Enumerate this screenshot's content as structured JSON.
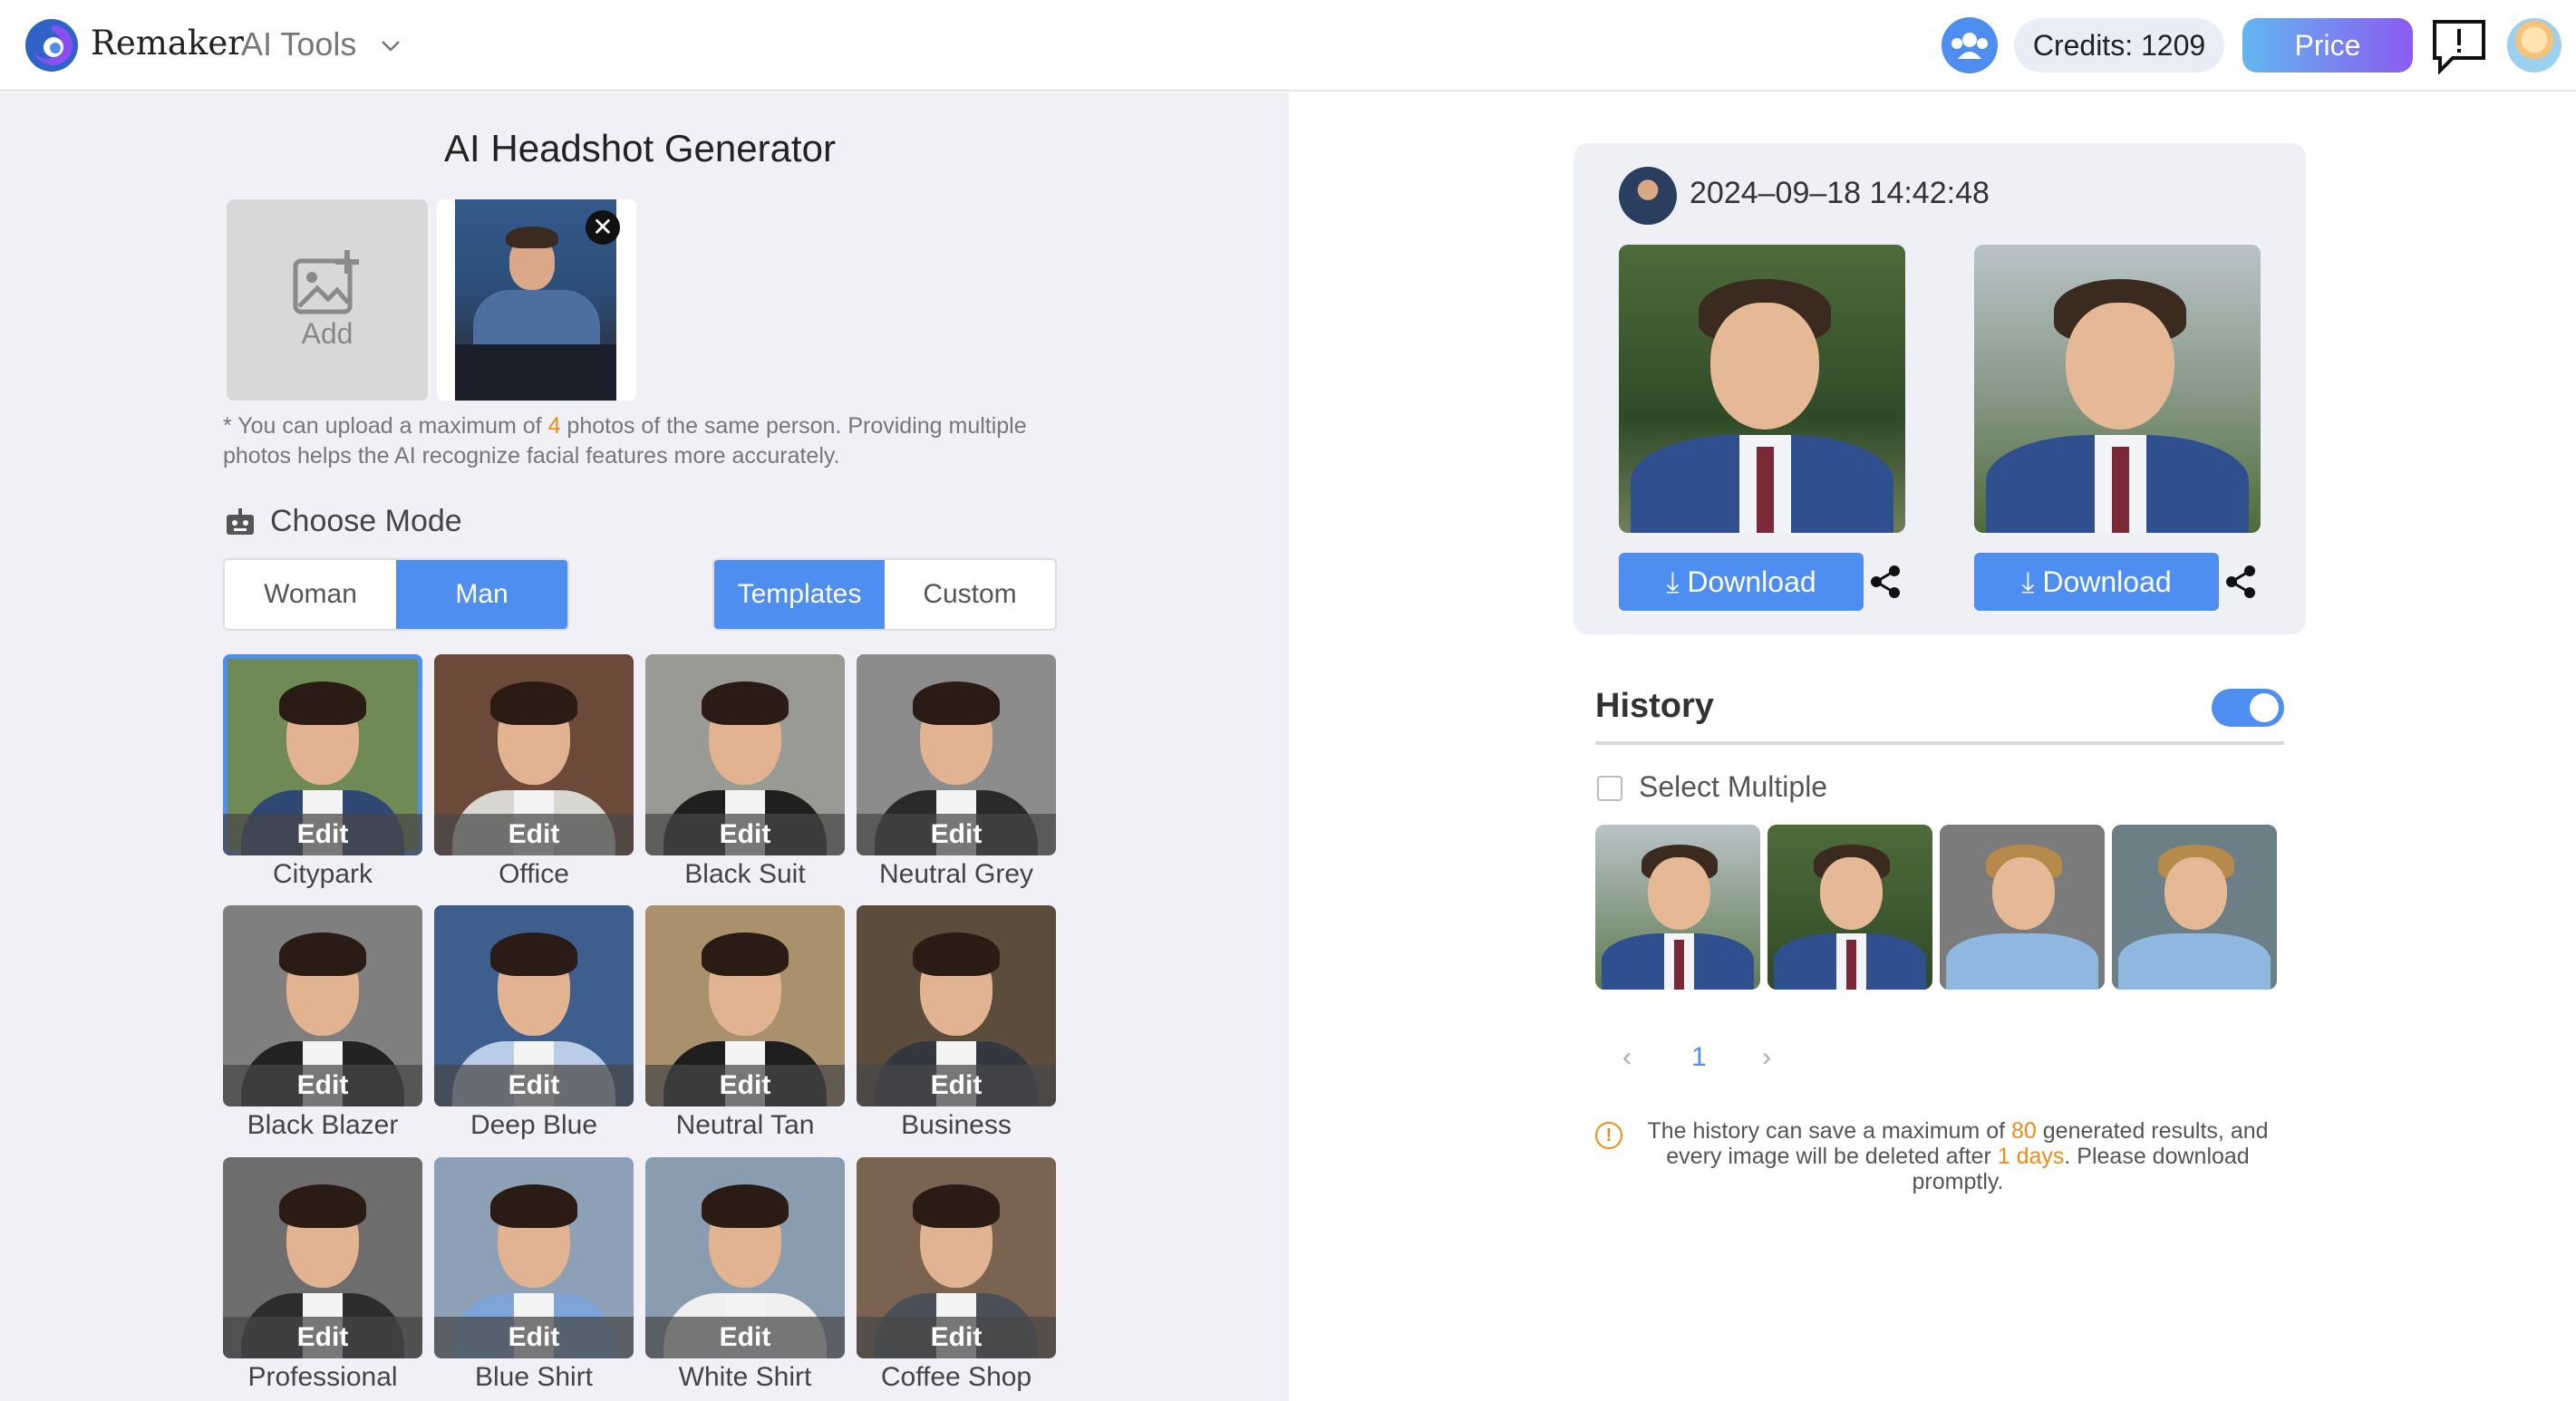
{
  "header": {
    "brand": "Remaker",
    "tools_label": "AI Tools",
    "credits": "Credits: 1209",
    "price_label": "Price"
  },
  "generator": {
    "title": "AI Headshot Generator",
    "add_label": "Add",
    "remove_symbol": "✕",
    "note_prefix": "* You can upload a maximum of ",
    "note_max": "4",
    "note_suffix": " photos of the same person. Providing multiple photos helps the AI recognize facial features more accurately.",
    "mode_title": "Choose Mode",
    "gender": [
      "Woman",
      "Man"
    ],
    "gender_selected": "Man",
    "mode": [
      "Templates",
      "Custom"
    ],
    "mode_selected": "Templates",
    "edit_label": "Edit",
    "templates": [
      {
        "name": "Citypark",
        "bg": "#6f8a54",
        "suit": "#2f4773",
        "selected": true
      },
      {
        "name": "Office",
        "bg": "#6b4a3a",
        "suit": "#d8d6d0",
        "selected": false
      },
      {
        "name": "Black Suit",
        "bg": "#9a9a94",
        "suit": "#1f1f1f",
        "selected": false
      },
      {
        "name": "Neutral Grey",
        "bg": "#8c8c8c",
        "suit": "#2a2a2a",
        "selected": false
      },
      {
        "name": "Black Blazer",
        "bg": "#7f7f7f",
        "suit": "#222222",
        "selected": false
      },
      {
        "name": "Deep Blue",
        "bg": "#3e5f8e",
        "suit": "#b9cde6",
        "selected": false
      },
      {
        "name": "Neutral Tan",
        "bg": "#a8916c",
        "suit": "#1e1e1e",
        "selected": false
      },
      {
        "name": "Business",
        "bg": "#5c4c3c",
        "suit": "#333840",
        "selected": false
      },
      {
        "name": "Professional",
        "bg": "#6d6d6d",
        "suit": "#2c2c2c",
        "selected": false
      },
      {
        "name": "Blue Shirt",
        "bg": "#8da0b6",
        "suit": "#7fa4d8",
        "selected": false
      },
      {
        "name": "White Shirt",
        "bg": "#8a9db0",
        "suit": "#f0f0f0",
        "selected": false
      },
      {
        "name": "Coffee Shop",
        "bg": "#7a6350",
        "suit": "#4a4f58",
        "selected": false
      }
    ]
  },
  "result": {
    "timestamp": "2024–09–18 14:42:48",
    "download_label": "Download"
  },
  "history": {
    "title": "History",
    "toggle_on": true,
    "select_multiple": "Select Multiple",
    "current_page": "1",
    "prev": "‹",
    "next": "›",
    "info_prefix": "The history can save a maximum of ",
    "info_max": "80",
    "info_mid": " generated results, and every image will be deleted after ",
    "info_days": "1 days",
    "info_suffix": ". Please download promptly."
  },
  "colors": {
    "accent": "#4d8ef0",
    "highlight": "#f08c16"
  }
}
